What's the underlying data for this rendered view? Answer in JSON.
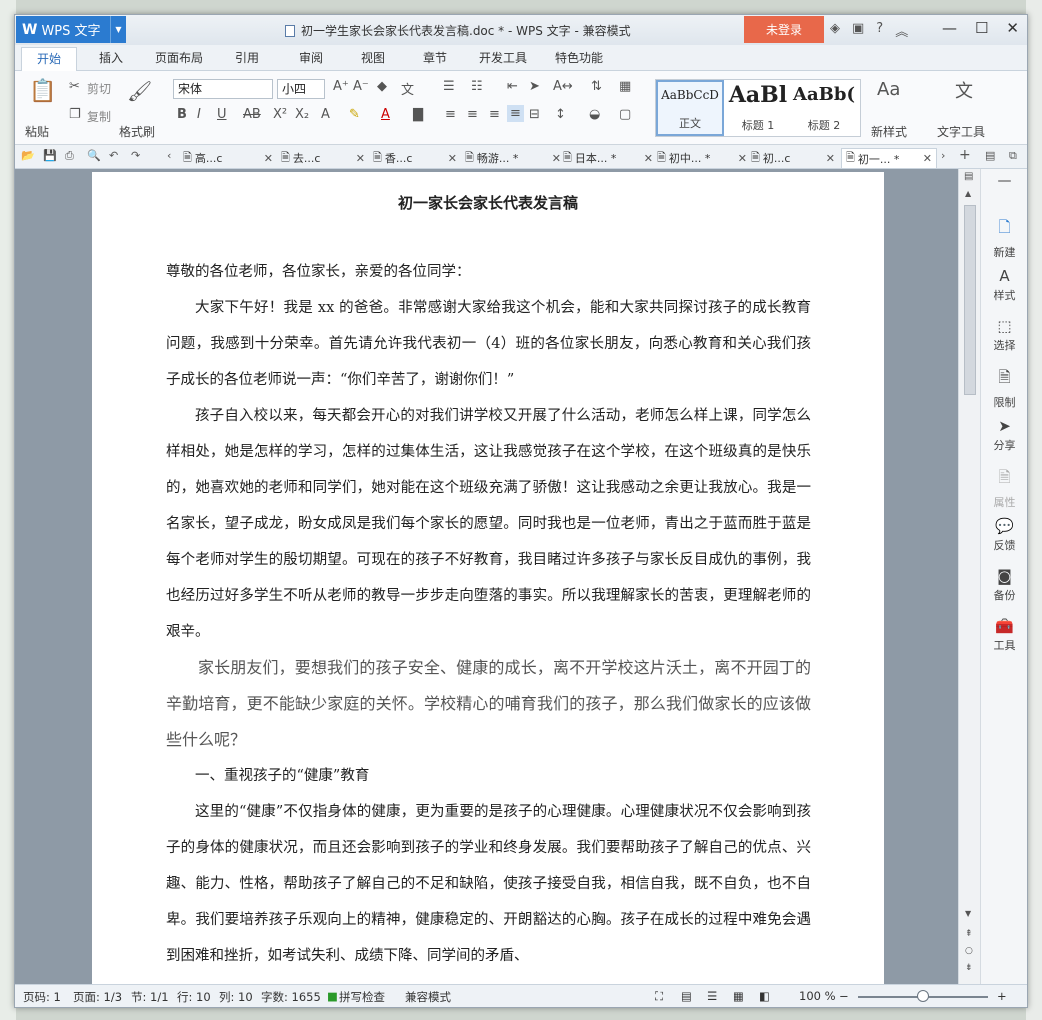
{
  "app": {
    "name": "WPS 文字",
    "title": "初一学生家长会家长代表发言稿.doc * - WPS 文字 - 兼容模式",
    "login": "未登录"
  },
  "menu": {
    "tabs": [
      "开始",
      "插入",
      "页面布局",
      "引用",
      "审阅",
      "视图",
      "章节",
      "开发工具",
      "特色功能"
    ]
  },
  "ribbon": {
    "paste": "粘贴",
    "cut": "剪切",
    "copy": "复制",
    "format_painter": "格式刷",
    "font_name": "宋体",
    "font_size": "小四",
    "styles": [
      {
        "sample": "AaBbCcD",
        "label": "正文"
      },
      {
        "sample": "AaBl",
        "label": "标题 1"
      },
      {
        "sample": "AaBb(",
        "label": "标题 2"
      }
    ],
    "new_style": "新样式",
    "text_tools": "文字工具"
  },
  "doc_tabs": [
    {
      "label": "高...c"
    },
    {
      "label": "去...c"
    },
    {
      "label": "香...c"
    },
    {
      "label": "畅游... *"
    },
    {
      "label": "日本... *"
    },
    {
      "label": "初中... *"
    },
    {
      "label": "初...c"
    },
    {
      "label": "初一... *"
    }
  ],
  "document": {
    "heading": "初一家长会家长代表发言稿",
    "p1": "尊敬的各位老师，各位家长，亲爱的各位同学：",
    "p2": "大家下午好！我是 xx 的爸爸。非常感谢大家给我这个机会，能和大家共同探讨孩子的成长教育问题，我感到十分荣幸。首先请允许我代表初一（4）班的各位家长朋友，向悉心教育和关心我们孩子成长的各位老师说一声：“你们辛苦了，谢谢你们！”",
    "p3": "孩子自入校以来，每天都会开心的对我们讲学校又开展了什么活动，老师怎么样上课，同学怎么样相处，她是怎样的学习，怎样的过集体生活，这让我感觉孩子在这个学校，在这个班级真的是快乐的，她喜欢她的老师和同学们，她对能在这个班级充满了骄傲！这让我感动之余更让我放心。我是一名家长，望子成龙，盼女成凤是我们每个家长的愿望。同时我也是一位老师，青出之于蓝而胜于蓝是每个老师对学生的殷切期望。可现在的孩子不好教育，我目睹过许多孩子与家长反目成仇的事例，我也经历过好多学生不听从老师的教导一步步走向堕落的事实。所以我理解家长的苦衷，更理解老师的艰辛。",
    "p4": "家长朋友们，要想我们的孩子安全、健康的成长，离不开学校这片沃土，离不开园丁的辛勤培育，更不能缺少家庭的关怀。学校精心的哺育我们的孩子，那么我们做家长的应该做些什么呢？",
    "p5": "一、重视孩子的“健康”教育",
    "p6": "这里的“健康”不仅指身体的健康，更为重要的是孩子的心理健康。心理健康状况不仅会影响到孩子的身体的健康状况，而且还会影响到孩子的学业和终身发展。我们要帮助孩子了解自己的优点、兴趣、能力、性格，帮助孩子了解自己的不足和缺陷，使孩子接受自我，相信自我，既不自负，也不自卑。我们要培养孩子乐观向上的精神，健康稳定的、开朗豁达的心胸。孩子在成长的过程中难免会遇到困难和挫折，如考试失利、成绩下降、同学间的矛盾、"
  },
  "side_panel": [
    "新建",
    "样式",
    "选择",
    "限制",
    "分享",
    "属性",
    "反馈",
    "备份",
    "工具"
  ],
  "status": {
    "page_num": "页码: 1",
    "pages": "页面: 1/3",
    "section": "节: 1/1",
    "row": "行: 10",
    "col": "列: 10",
    "words": "字数: 1655",
    "spell": "拼写检查",
    "mode": "兼容模式",
    "zoom": "100 %"
  }
}
